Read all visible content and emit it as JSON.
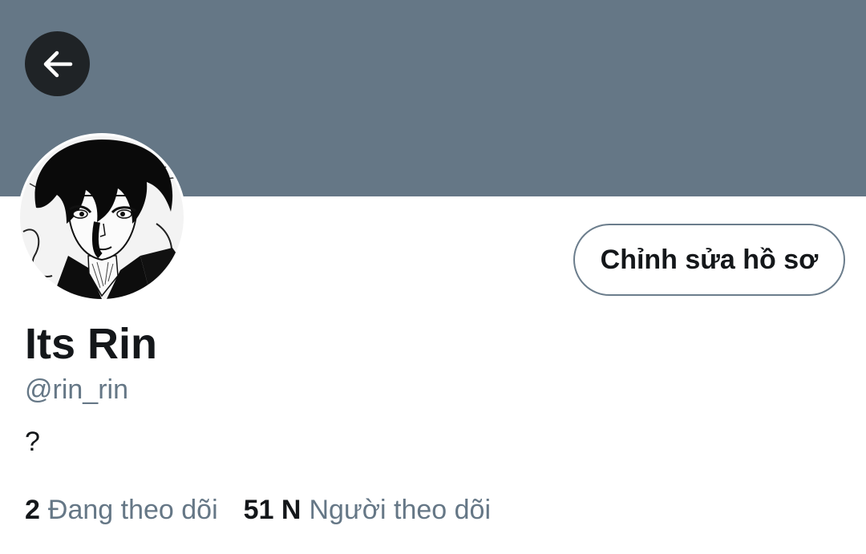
{
  "header": {
    "back_icon": "arrow-left-icon",
    "banner_color": "#657786"
  },
  "profile": {
    "display_name": "Its Rin",
    "handle": "@rin_rin",
    "bio": "?",
    "edit_button_label": "Chỉnh sửa hồ sơ"
  },
  "stats": {
    "following_count": "2",
    "following_label": "Đang theo dõi",
    "followers_count": "51 N",
    "followers_label": "Người theo dõi"
  },
  "colors": {
    "text_primary": "#14171a",
    "text_secondary": "#657786"
  }
}
